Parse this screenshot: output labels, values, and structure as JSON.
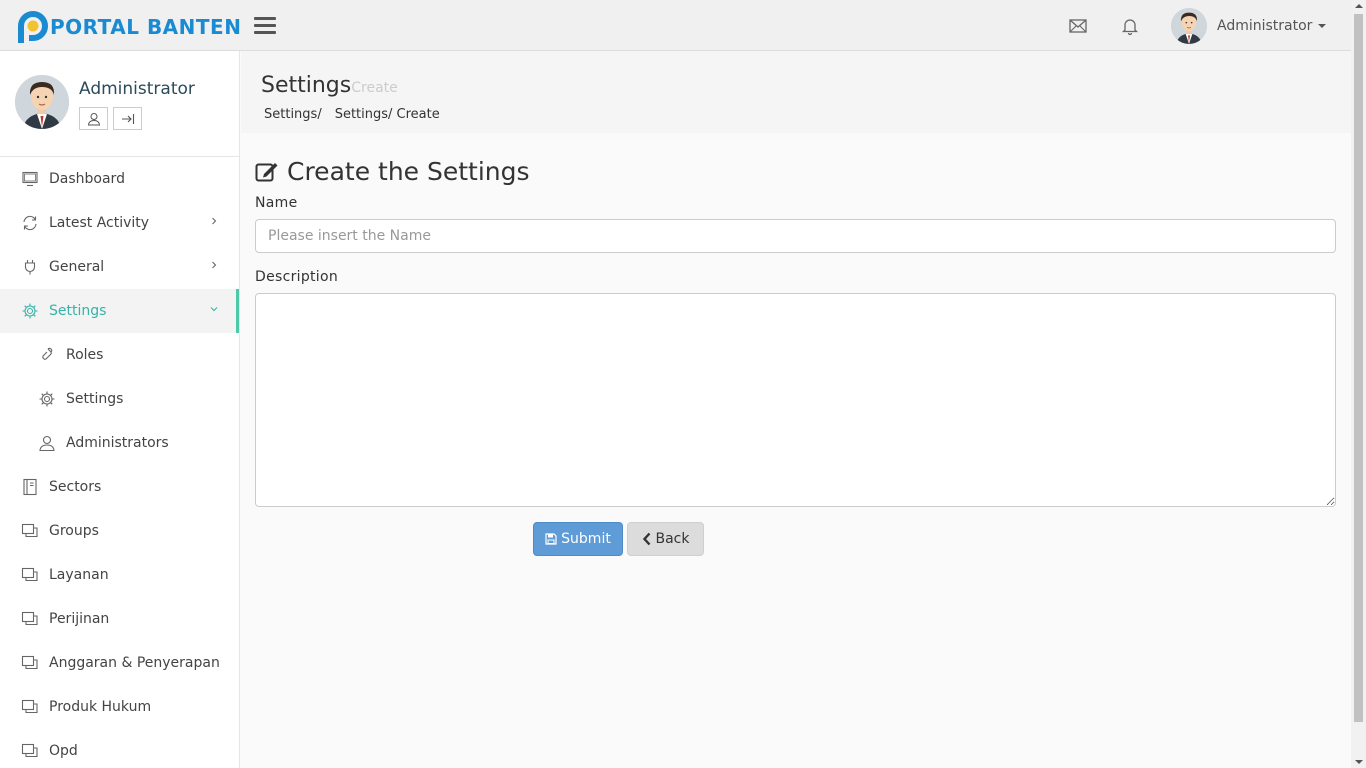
{
  "brand": {
    "name": "PORTAL BANTEN",
    "color": "#1a8ad1"
  },
  "topbar": {
    "user_name": "Administrator",
    "icons": [
      "menu-icon",
      "mail-icon",
      "bell-icon",
      "chevron-down-icon"
    ]
  },
  "sidebar": {
    "profile_name": "Administrator",
    "items": [
      {
        "label": "Dashboard",
        "icon": "monitor-icon"
      },
      {
        "label": "Latest Activity",
        "icon": "refresh-icon"
      },
      {
        "label": "General",
        "icon": "plug-icon"
      },
      {
        "label": "Settings",
        "icon": "gear-icon",
        "active": true
      },
      {
        "label": "Roles",
        "icon": "link-icon"
      },
      {
        "label": "Settings",
        "icon": "gear-icon"
      },
      {
        "label": "Administrators",
        "icon": "user-icon"
      },
      {
        "label": "Sectors",
        "icon": "notebook-icon"
      },
      {
        "label": "Groups",
        "icon": "window-icon"
      },
      {
        "label": "Layanan",
        "icon": "window-icon"
      },
      {
        "label": "Perijinan",
        "icon": "window-icon"
      },
      {
        "label": "Anggaran & Penyerapan",
        "icon": "window-icon"
      },
      {
        "label": "Produk Hukum",
        "icon": "window-icon"
      },
      {
        "label": "Opd",
        "icon": "window-icon"
      }
    ],
    "accent_color": "#36b3a8"
  },
  "header": {
    "title": "Settings",
    "subtitle": "Create",
    "breadcrumb": [
      "Settings/",
      "Settings/ Create"
    ]
  },
  "form": {
    "title": "Create the Settings",
    "name_label": "Name",
    "name_placeholder": "Please insert the Name",
    "name_value": "",
    "description_label": "Description",
    "description_value": "",
    "submit_label": "Submit",
    "back_label": "Back",
    "submit_color": "#5f9bd6"
  }
}
